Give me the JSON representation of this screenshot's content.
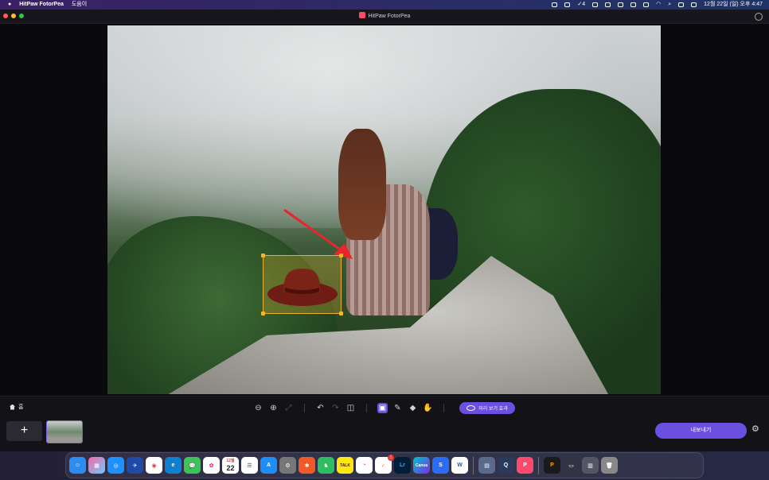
{
  "menubar": {
    "app_name": "HitPaw FotorPea",
    "menu_help": "도움이",
    "battery_label": "4",
    "datetime": "12월 22일 (일) 오후 4:47"
  },
  "window": {
    "title": "HitPaw FotorPea"
  },
  "toolbar": {
    "home_label": "홈",
    "zoom_out_icon": "zoom-out-icon",
    "zoom_in_icon": "zoom-in-icon",
    "fit_icon": "fit-screen-icon",
    "undo_icon": "undo-icon",
    "redo_icon": "redo-icon",
    "compare_icon": "compare-icon",
    "ai_select_icon": "ai-select-icon",
    "brush_icon": "brush-icon",
    "eraser_icon": "eraser-icon",
    "hand_icon": "hand-icon",
    "preview_label": "미리 보기 효과"
  },
  "filmstrip": {
    "add_label": "+",
    "export_label": "내보내기"
  },
  "colors": {
    "accent": "#6b4fe0",
    "selection": "#e9b22b",
    "annotation_arrow": "#e8262a"
  },
  "dock": {
    "calendar_month": "12월",
    "calendar_day": "22",
    "kakao_label": "TALK",
    "lightroom_label": "Lr",
    "canva_label": "Canva",
    "word_label": "W",
    "badge_count": "2"
  }
}
